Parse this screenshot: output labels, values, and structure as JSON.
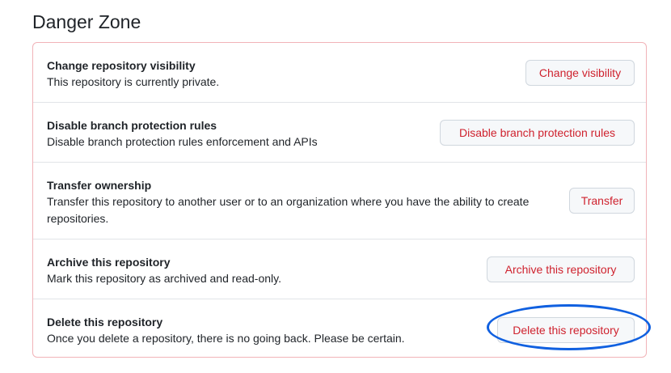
{
  "page": {
    "title": "Danger Zone"
  },
  "colors": {
    "danger_text": "#cf222e",
    "box_border": "#f1b3b8",
    "annotation_ring": "#1060e0"
  },
  "rows": [
    {
      "title": "Change repository visibility",
      "description": "This repository is currently private.",
      "button": "Change visibility"
    },
    {
      "title": "Disable branch protection rules",
      "description": "Disable branch protection rules enforcement and APIs",
      "button": "Disable branch protection rules"
    },
    {
      "title": "Transfer ownership",
      "description": "Transfer this repository to another user or to an organization where you have the ability to create repositories.",
      "button": "Transfer"
    },
    {
      "title": "Archive this repository",
      "description": "Mark this repository as archived and read-only.",
      "button": "Archive this repository"
    },
    {
      "title": "Delete this repository",
      "description": "Once you delete a repository, there is no going back. Please be certain.",
      "button": "Delete this repository"
    }
  ]
}
